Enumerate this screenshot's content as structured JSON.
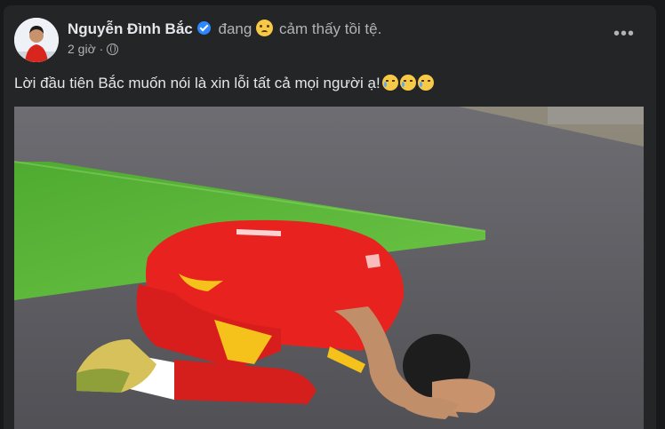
{
  "post": {
    "author": "Nguyễn Đình Bắc",
    "feeling_prefix": "đang",
    "feeling_emoji": "confused-face-icon",
    "feeling_text": "cảm thấy tồi tệ.",
    "time": "2 giờ",
    "separator": "·",
    "privacy_icon": "globe-icon",
    "more_label": "•••",
    "message": "Lời đầu tiên Bắc muốn nói là xin lỗi tất cả mọi người ạ!",
    "message_emojis": [
      "crying-face-icon",
      "crying-face-icon",
      "crying-face-icon"
    ],
    "photo_alt": "Player in red kit kneeling on the pitch"
  },
  "colors": {
    "background": "#18191a",
    "card": "#242526",
    "text_primary": "#e4e6eb",
    "text_secondary": "#b0b3b8",
    "verified": "#2d88ff",
    "jersey_red": "#e8231f",
    "pitch_green": "#5db63a"
  }
}
